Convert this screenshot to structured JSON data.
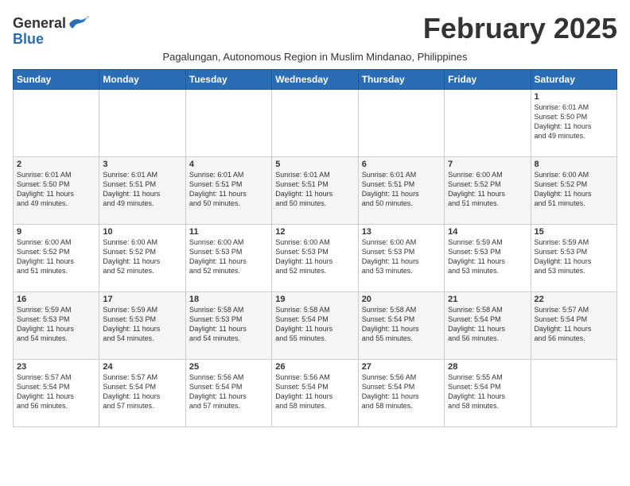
{
  "header": {
    "logo_general": "General",
    "logo_blue": "Blue",
    "month_title": "February 2025",
    "subtitle": "Pagalungan, Autonomous Region in Muslim Mindanao, Philippines"
  },
  "weekdays": [
    "Sunday",
    "Monday",
    "Tuesday",
    "Wednesday",
    "Thursday",
    "Friday",
    "Saturday"
  ],
  "weeks": [
    [
      {
        "day": "",
        "info": ""
      },
      {
        "day": "",
        "info": ""
      },
      {
        "day": "",
        "info": ""
      },
      {
        "day": "",
        "info": ""
      },
      {
        "day": "",
        "info": ""
      },
      {
        "day": "",
        "info": ""
      },
      {
        "day": "1",
        "info": "Sunrise: 6:01 AM\nSunset: 5:50 PM\nDaylight: 11 hours\nand 49 minutes."
      }
    ],
    [
      {
        "day": "2",
        "info": "Sunrise: 6:01 AM\nSunset: 5:50 PM\nDaylight: 11 hours\nand 49 minutes."
      },
      {
        "day": "3",
        "info": "Sunrise: 6:01 AM\nSunset: 5:51 PM\nDaylight: 11 hours\nand 49 minutes."
      },
      {
        "day": "4",
        "info": "Sunrise: 6:01 AM\nSunset: 5:51 PM\nDaylight: 11 hours\nand 50 minutes."
      },
      {
        "day": "5",
        "info": "Sunrise: 6:01 AM\nSunset: 5:51 PM\nDaylight: 11 hours\nand 50 minutes."
      },
      {
        "day": "6",
        "info": "Sunrise: 6:01 AM\nSunset: 5:51 PM\nDaylight: 11 hours\nand 50 minutes."
      },
      {
        "day": "7",
        "info": "Sunrise: 6:00 AM\nSunset: 5:52 PM\nDaylight: 11 hours\nand 51 minutes."
      },
      {
        "day": "8",
        "info": "Sunrise: 6:00 AM\nSunset: 5:52 PM\nDaylight: 11 hours\nand 51 minutes."
      }
    ],
    [
      {
        "day": "9",
        "info": "Sunrise: 6:00 AM\nSunset: 5:52 PM\nDaylight: 11 hours\nand 51 minutes."
      },
      {
        "day": "10",
        "info": "Sunrise: 6:00 AM\nSunset: 5:52 PM\nDaylight: 11 hours\nand 52 minutes."
      },
      {
        "day": "11",
        "info": "Sunrise: 6:00 AM\nSunset: 5:53 PM\nDaylight: 11 hours\nand 52 minutes."
      },
      {
        "day": "12",
        "info": "Sunrise: 6:00 AM\nSunset: 5:53 PM\nDaylight: 11 hours\nand 52 minutes."
      },
      {
        "day": "13",
        "info": "Sunrise: 6:00 AM\nSunset: 5:53 PM\nDaylight: 11 hours\nand 53 minutes."
      },
      {
        "day": "14",
        "info": "Sunrise: 5:59 AM\nSunset: 5:53 PM\nDaylight: 11 hours\nand 53 minutes."
      },
      {
        "day": "15",
        "info": "Sunrise: 5:59 AM\nSunset: 5:53 PM\nDaylight: 11 hours\nand 53 minutes."
      }
    ],
    [
      {
        "day": "16",
        "info": "Sunrise: 5:59 AM\nSunset: 5:53 PM\nDaylight: 11 hours\nand 54 minutes."
      },
      {
        "day": "17",
        "info": "Sunrise: 5:59 AM\nSunset: 5:53 PM\nDaylight: 11 hours\nand 54 minutes."
      },
      {
        "day": "18",
        "info": "Sunrise: 5:58 AM\nSunset: 5:53 PM\nDaylight: 11 hours\nand 54 minutes."
      },
      {
        "day": "19",
        "info": "Sunrise: 5:58 AM\nSunset: 5:54 PM\nDaylight: 11 hours\nand 55 minutes."
      },
      {
        "day": "20",
        "info": "Sunrise: 5:58 AM\nSunset: 5:54 PM\nDaylight: 11 hours\nand 55 minutes."
      },
      {
        "day": "21",
        "info": "Sunrise: 5:58 AM\nSunset: 5:54 PM\nDaylight: 11 hours\nand 56 minutes."
      },
      {
        "day": "22",
        "info": "Sunrise: 5:57 AM\nSunset: 5:54 PM\nDaylight: 11 hours\nand 56 minutes."
      }
    ],
    [
      {
        "day": "23",
        "info": "Sunrise: 5:57 AM\nSunset: 5:54 PM\nDaylight: 11 hours\nand 56 minutes."
      },
      {
        "day": "24",
        "info": "Sunrise: 5:57 AM\nSunset: 5:54 PM\nDaylight: 11 hours\nand 57 minutes."
      },
      {
        "day": "25",
        "info": "Sunrise: 5:56 AM\nSunset: 5:54 PM\nDaylight: 11 hours\nand 57 minutes."
      },
      {
        "day": "26",
        "info": "Sunrise: 5:56 AM\nSunset: 5:54 PM\nDaylight: 11 hours\nand 58 minutes."
      },
      {
        "day": "27",
        "info": "Sunrise: 5:56 AM\nSunset: 5:54 PM\nDaylight: 11 hours\nand 58 minutes."
      },
      {
        "day": "28",
        "info": "Sunrise: 5:55 AM\nSunset: 5:54 PM\nDaylight: 11 hours\nand 58 minutes."
      },
      {
        "day": "",
        "info": ""
      }
    ]
  ]
}
